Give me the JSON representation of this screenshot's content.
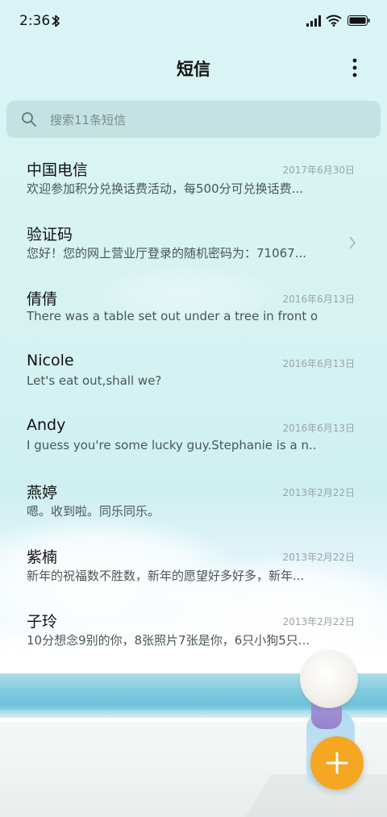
{
  "status_bar": {
    "time": "2:36"
  },
  "header": {
    "title": "短信"
  },
  "search": {
    "placeholder": "搜索11条短信"
  },
  "messages": [
    {
      "sender": "中国电信",
      "date": "2017年6月30日",
      "preview": "欢迎参加积分兑换话费活动，每500分可兑换话费..."
    },
    {
      "sender": "验证码",
      "date": "",
      "preview": "您好！您的网上营业厅登录的随机密码为：71067..."
    },
    {
      "sender": "倩倩",
      "date": "2016年6月13日",
      "preview": "There was a table set out under a tree in front o..."
    },
    {
      "sender": "Nicole",
      "date": "2016年6月13日",
      "preview": "Let's eat out,shall we?"
    },
    {
      "sender": "Andy",
      "date": "2016年6月13日",
      "preview": "I guess you're some lucky guy.Stephanie is a n..."
    },
    {
      "sender": "燕婷",
      "date": "2013年2月22日",
      "preview": "嗯。收到啦。同乐同乐。"
    },
    {
      "sender": "紫楠",
      "date": "2013年2月22日",
      "preview": "新年的祝福数不胜数，新年的愿望好多好多，新年..."
    },
    {
      "sender": "子玲",
      "date": "2013年2月22日",
      "preview": "10分想念9别的你，8张照片7张是你，6只小狗5只..."
    }
  ],
  "colors": {
    "accent": "#f5a623",
    "text_primary": "#111111",
    "text_secondary": "#4a5656",
    "date": "#9aa3a3"
  },
  "icons": {
    "bluetooth": "bluetooth-icon",
    "signal": "signal-icon",
    "wifi": "wifi-icon",
    "battery": "battery-icon",
    "more": "more-vertical-icon",
    "search": "search-icon",
    "chevron": "chevron-right-icon",
    "add": "plus-icon"
  }
}
